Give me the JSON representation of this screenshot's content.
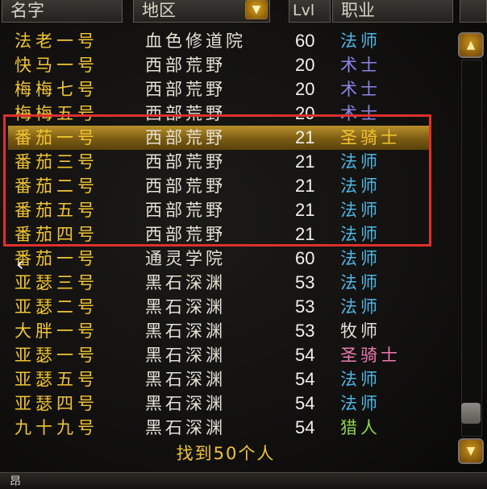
{
  "header": {
    "name": "名字",
    "zone": "地区",
    "zone_dropdown_icon": "arrow-down-icon",
    "level": "Lvl",
    "class": "职业"
  },
  "rows": [
    {
      "name": "法老一号",
      "zone": "血色修道院",
      "level": "60",
      "class": "法师",
      "class_color": "#4fb7e6"
    },
    {
      "name": "快马一号",
      "zone": "西部荒野",
      "level": "20",
      "class": "术士",
      "class_color": "#8a86e8"
    },
    {
      "name": "梅梅七号",
      "zone": "西部荒野",
      "level": "20",
      "class": "术士",
      "class_color": "#8a86e8"
    },
    {
      "name": "梅梅五号",
      "zone": "西部荒野",
      "level": "20",
      "class": "术士",
      "class_color": "#8a86e8"
    },
    {
      "name": "番茄一号",
      "zone": "西部荒野",
      "level": "21",
      "class": "圣骑士",
      "class_color": "#f2c531",
      "selected": true
    },
    {
      "name": "番茄三号",
      "zone": "西部荒野",
      "level": "21",
      "class": "法师",
      "class_color": "#4fb7e6"
    },
    {
      "name": "番茄二号",
      "zone": "西部荒野",
      "level": "21",
      "class": "法师",
      "class_color": "#4fb7e6"
    },
    {
      "name": "番茄五号",
      "zone": "西部荒野",
      "level": "21",
      "class": "法师",
      "class_color": "#4fb7e6"
    },
    {
      "name": "番茄四号",
      "zone": "西部荒野",
      "level": "21",
      "class": "法师",
      "class_color": "#4fb7e6"
    },
    {
      "name": "番茄一号",
      "zone": "通灵学院",
      "level": "60",
      "class": "法师",
      "class_color": "#4fb7e6"
    },
    {
      "name": "亚瑟三号",
      "zone": "黑石深渊",
      "level": "53",
      "class": "法师",
      "class_color": "#4fb7e6"
    },
    {
      "name": "亚瑟二号",
      "zone": "黑石深渊",
      "level": "53",
      "class": "法师",
      "class_color": "#4fb7e6"
    },
    {
      "name": "大胖一号",
      "zone": "黑石深渊",
      "level": "53",
      "class": "牧师",
      "class_color": "#e6e1d6"
    },
    {
      "name": "亚瑟一号",
      "zone": "黑石深渊",
      "level": "54",
      "class": "圣骑士",
      "class_color": "#f07ab0"
    },
    {
      "name": "亚瑟五号",
      "zone": "黑石深渊",
      "level": "54",
      "class": "法师",
      "class_color": "#4fb7e6"
    },
    {
      "name": "亚瑟四号",
      "zone": "黑石深渊",
      "level": "54",
      "class": "法师",
      "class_color": "#4fb7e6"
    },
    {
      "name": "九十九号",
      "zone": "黑石深渊",
      "level": "54",
      "class": "猎人",
      "class_color": "#8fd34a"
    }
  ],
  "footer": {
    "found_text": "找到50个人",
    "bottom_label": "昂"
  },
  "scrollbar": {
    "up_icon": "arrow-up-icon",
    "down_icon": "arrow-down-icon"
  },
  "annotation": {
    "box_color": "#e0302d",
    "cursor_icon": "chevron-left-icon"
  }
}
